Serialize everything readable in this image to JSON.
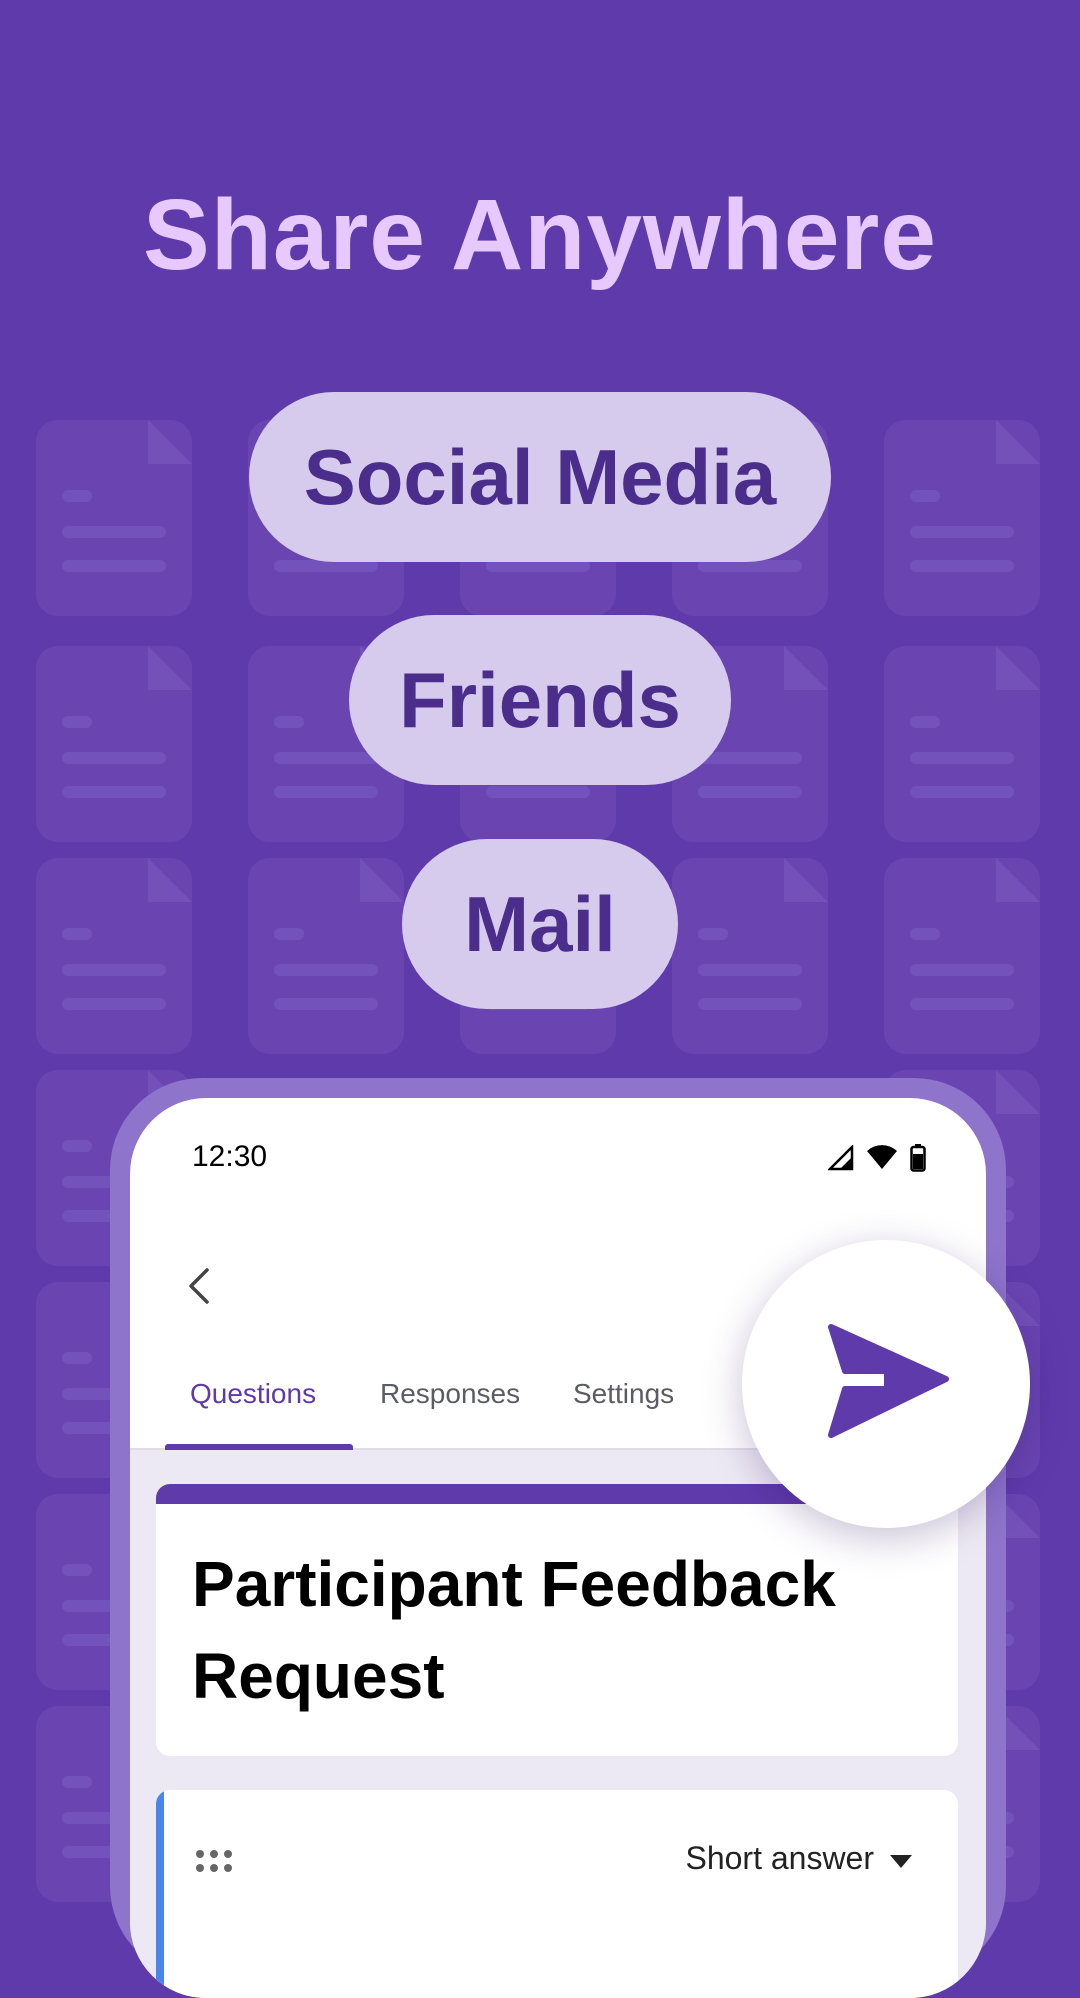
{
  "headline": "Share Anywhere",
  "share_options": [
    "Social Media",
    "Friends",
    "Mail"
  ],
  "phone": {
    "status_time": "12:30",
    "tabs": [
      "Questions",
      "Responses",
      "Settings"
    ],
    "active_tab": "Questions",
    "form_title": "Participant Feedback Request",
    "question_type": "Short answer"
  },
  "icons": {
    "back": "chevron-left-icon",
    "send": "send-icon",
    "signal": "signal-icon",
    "wifi": "wifi-icon",
    "battery": "battery-icon",
    "drag": "drag-handle-icon",
    "dropdown": "caret-down-icon"
  },
  "colors": {
    "background": "#5f3aab",
    "headline": "#e7c9ff",
    "pill_bg": "#d6cbec",
    "pill_text": "#4b2d8c",
    "accent": "#5f3aab",
    "question_accent": "#4a86e8"
  }
}
